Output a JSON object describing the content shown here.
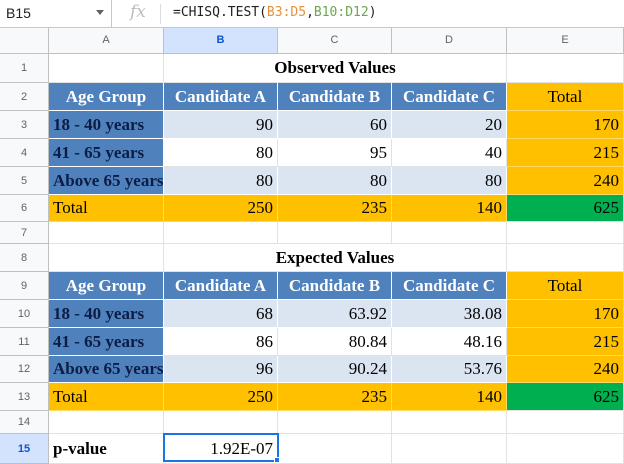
{
  "formula_bar": {
    "cell_ref": "B15",
    "fx": "fx",
    "formula_prefix": "=CHISQ.TEST(",
    "formula_range1": "B3:D5",
    "formula_comma": ",",
    "formula_range2": "B10:D12",
    "formula_suffix": ")"
  },
  "columns": [
    "A",
    "B",
    "C",
    "D",
    "E"
  ],
  "rows": [
    "1",
    "2",
    "3",
    "4",
    "5",
    "6",
    "7",
    "8",
    "9",
    "10",
    "11",
    "12",
    "13",
    "14",
    "15"
  ],
  "observed": {
    "title": "Observed Values",
    "headers": [
      "Age Group",
      "Candidate A",
      "Candidate B",
      "Candidate C",
      "Total"
    ],
    "rows": [
      {
        "group": "18 - 40 years",
        "a": "90",
        "b": "60",
        "c": "20",
        "total": "170"
      },
      {
        "group": "41 - 65 years",
        "a": "80",
        "b": "95",
        "c": "40",
        "total": "215"
      },
      {
        "group": "Above 65 years",
        "a": "80",
        "b": "80",
        "c": "80",
        "total": "240"
      }
    ],
    "totals": {
      "label": "Total",
      "a": "250",
      "b": "235",
      "c": "140",
      "total": "625"
    }
  },
  "expected": {
    "title": "Expected Values",
    "headers": [
      "Age Group",
      "Candidate A",
      "Candidate B",
      "Candidate C",
      "Total"
    ],
    "rows": [
      {
        "group": "18 - 40 years",
        "a": "68",
        "b": "63.92",
        "c": "38.08",
        "total": "170"
      },
      {
        "group": "41 - 65 years",
        "a": "86",
        "b": "80.84",
        "c": "48.16",
        "total": "215"
      },
      {
        "group": "Above 65 years",
        "a": "96",
        "b": "90.24",
        "c": "53.76",
        "total": "240"
      }
    ],
    "totals": {
      "label": "Total",
      "a": "250",
      "b": "235",
      "c": "140",
      "total": "625"
    }
  },
  "result": {
    "label": "p-value",
    "value": "1.92E-07"
  },
  "colors": {
    "header_blue": "#4f81bd",
    "light_blue": "#dbe5f1",
    "gold": "#ffc000",
    "green": "#00b050",
    "selection": "#1a73e8"
  },
  "icons": {
    "namebox_dropdown": "chevron-down-icon",
    "function": "fx-icon"
  }
}
